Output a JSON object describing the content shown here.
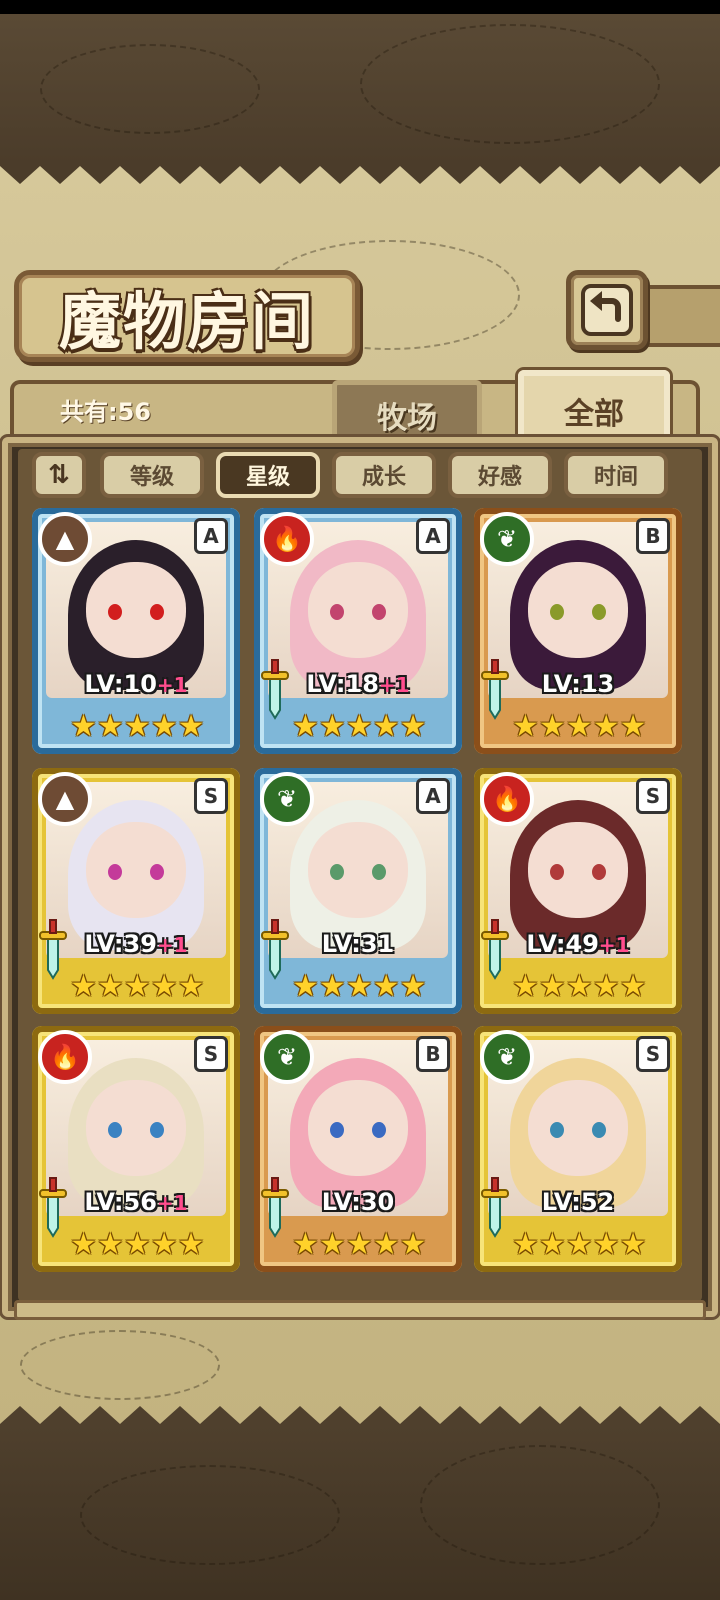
{
  "header": {
    "title": "魔物房间"
  },
  "tabs": {
    "count_label": "共有:56",
    "ranch_label": "牧场",
    "all_label": "全部"
  },
  "sort": {
    "toggle_label": "⇅",
    "buttons": [
      "等级",
      "星级",
      "成长",
      "好感",
      "时间"
    ],
    "active": "星级"
  },
  "monsters": [
    {
      "level": "LV:10",
      "plus": "+1",
      "rank": "A",
      "element": "earth",
      "frame": "blue",
      "stars": 5
    },
    {
      "level": "LV:18",
      "plus": "+1",
      "rank": "A",
      "element": "fire",
      "frame": "blue",
      "stars": 5
    },
    {
      "level": "LV:13",
      "plus": "",
      "rank": "B",
      "element": "nature",
      "frame": "orange",
      "stars": 5
    },
    {
      "level": "LV:39",
      "plus": "+1",
      "rank": "S",
      "element": "earth",
      "frame": "gold",
      "stars": 5
    },
    {
      "level": "LV:31",
      "plus": "",
      "rank": "A",
      "element": "nature",
      "frame": "blue",
      "stars": 5
    },
    {
      "level": "LV:49",
      "plus": "+1",
      "rank": "S",
      "element": "fire",
      "frame": "gold",
      "stars": 5
    },
    {
      "level": "LV:56",
      "plus": "+1",
      "rank": "S",
      "element": "fire",
      "frame": "gold",
      "stars": 5
    },
    {
      "level": "LV:30",
      "plus": "",
      "rank": "B",
      "element": "nature",
      "frame": "orange",
      "stars": 5
    },
    {
      "level": "LV:52",
      "plus": "",
      "rank": "S",
      "element": "nature",
      "frame": "gold",
      "stars": 5
    }
  ],
  "colors": {
    "fire": "#c8231f",
    "earth": "#6e4b34",
    "nature": "#2f6e26"
  },
  "icons": {
    "back": "return-arrow-icon",
    "sword": "sword-icon",
    "star": "star-icon"
  }
}
